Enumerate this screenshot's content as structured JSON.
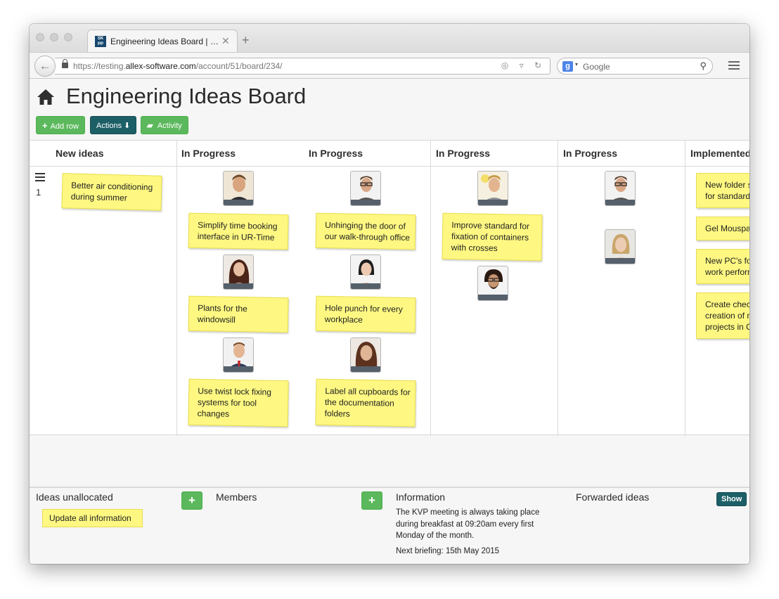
{
  "browser": {
    "tab_title": "Engineering Ideas Board | all...",
    "tab_close": "✕",
    "new_tab": "+",
    "back": "←",
    "url_prefix": "https://testing.",
    "url_domain": "allex-software.com",
    "url_path": "/account/51/board/234/",
    "url_icons": "◎ ▿ ↻",
    "search_engine_letter": "g",
    "search_dropdown": "▾",
    "search_placeholder": "Google",
    "search_icon": "⚲",
    "favicon_text": "SK PP"
  },
  "page": {
    "title": "Engineering Ideas Board"
  },
  "toolbar": {
    "add_row_glyph": "+",
    "add_row": "Add row",
    "actions": "Actions",
    "actions_glyph": "⬇",
    "activity_glyph": "▰",
    "activity": "Activity"
  },
  "board": {
    "columns": [
      {
        "title": "New ideas"
      },
      {
        "title": "In Progress"
      },
      {
        "title": "In Progress"
      },
      {
        "title": "In Progress"
      },
      {
        "title": "In Progress"
      },
      {
        "title": "Implemented"
      }
    ],
    "row_number": "1",
    "notes": {
      "new_ideas": [
        "Better air conditioning\nduring summer"
      ],
      "in_progress_1": [
        "Simplify time booking\ninterface in UR-Time",
        "Plants for the\nwindowsill",
        "Use twist lock fixing\nsystems for tool\nchanges"
      ],
      "in_progress_2": [
        "Unhinging the door of\nour walk-through office",
        "Hole punch for every\nworkplace",
        "Label all cupboards for\nthe documentation\nfolders"
      ],
      "in_progress_3": [
        "Improve standard for\nfixation of containers\nwith crosses"
      ],
      "implemented": [
        "New folder s\nfor standard",
        "Gel Mouspa",
        "New PC's fo\nwork perform",
        "Create chec\ncreation of n\nprojects in C"
      ]
    }
  },
  "footer": {
    "ideas_unallocated": "Ideas unallocated",
    "unallocated_note": "Update all information",
    "plus": "+",
    "members": "Members",
    "information": "Information",
    "info_text": "The KVP meeting is always taking place during breakfast at 09:20am every first Monday of the month.",
    "next_briefing": "Next briefing: 15th May 2015",
    "forwarded_ideas": "Forwarded ideas",
    "show": "Show"
  },
  "colors": {
    "note_yellow": "#fef882",
    "button_green": "#5cb85c",
    "button_teal": "#1d5f66"
  }
}
